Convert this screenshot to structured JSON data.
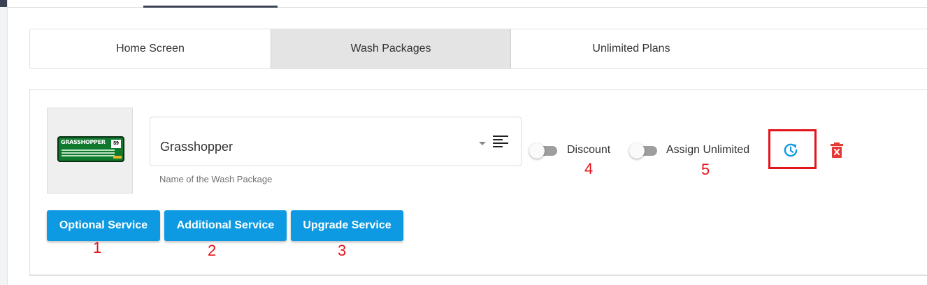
{
  "tabs": [
    {
      "label": "Home Screen",
      "active": false
    },
    {
      "label": "Wash Packages",
      "active": true
    },
    {
      "label": "Unlimited Plans",
      "active": false
    }
  ],
  "package": {
    "image_brand": "GRASSHOPPER",
    "image_price": "$9",
    "name_value": "Grasshopper",
    "name_helper": "Name of the Wash Package",
    "toggles": {
      "discount_label": "Discount",
      "assign_unlimited_label": "Assign Unlimited"
    }
  },
  "service_buttons": {
    "optional": "Optional Service",
    "additional": "Additional Service",
    "upgrade": "Upgrade Service"
  },
  "markers": [
    "1",
    "2",
    "3",
    "4",
    "5"
  ],
  "colors": {
    "primary_button": "#0d9ae3",
    "highlight": "#e4141b",
    "delete_icon": "#e53935",
    "history_icon": "#0d9ae3",
    "active_tab": "#e4e4e4"
  },
  "icons": {
    "history": "history-icon",
    "delete": "delete-icon",
    "notes": "text-lines-icon",
    "dropdown": "chevron-down-icon"
  }
}
